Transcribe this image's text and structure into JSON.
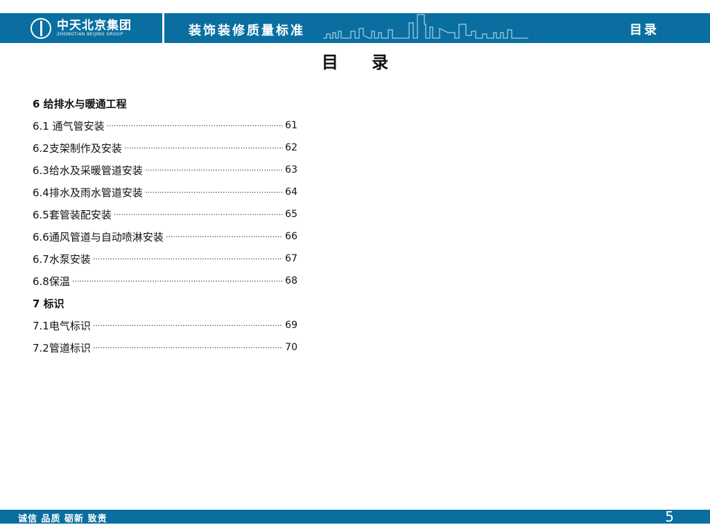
{
  "header": {
    "logo_cn": "中天北京集团",
    "logo_en": "ZHONGTIAN BEIJING GROUP",
    "doc_title": "装饰装修质量标准",
    "section": "目录"
  },
  "page_title": "目 录",
  "toc": [
    {
      "label": "6 给排水与暖通工程",
      "page": "",
      "chapter": true
    },
    {
      "label": "6.1 通气管安装",
      "page": "61"
    },
    {
      "label": "6.2支架制作及安装",
      "page": "62"
    },
    {
      "label": "6.3给水及采暖管道安装",
      "page": "63"
    },
    {
      "label": "6.4排水及雨水管道安装",
      "page": "64"
    },
    {
      "label": "6.5套管装配安装",
      "page": "65"
    },
    {
      "label": "6.6通风管道与自动喷淋安装",
      "page": "66"
    },
    {
      "label": "6.7水泵安装",
      "page": "67"
    },
    {
      "label": "6.8保温",
      "page": "68"
    },
    {
      "label": "7 标识",
      "page": "",
      "chapter": true
    },
    {
      "label": "7.1电气标识",
      "page": "69"
    },
    {
      "label": "7.2管道标识",
      "page": "70"
    }
  ],
  "footer": {
    "motto": "诚信 品质 砺新 致责",
    "page_number": "5"
  },
  "colors": {
    "brand": "#0a6fa0"
  }
}
